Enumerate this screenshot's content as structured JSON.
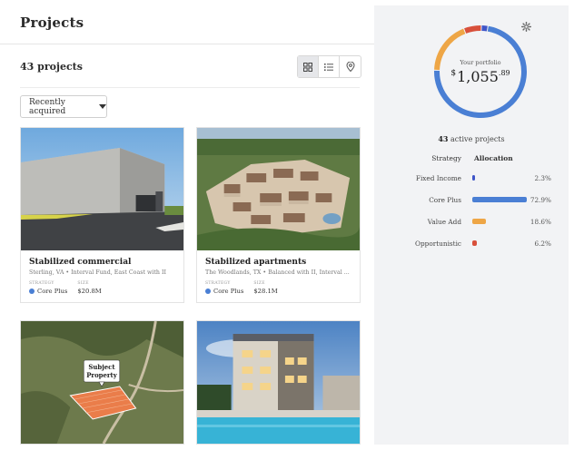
{
  "header": {
    "title": "Projects"
  },
  "toolbar": {
    "count": "43 projects",
    "views": [
      {
        "name": "grid",
        "icon": "grid-icon",
        "active": true
      },
      {
        "name": "list",
        "icon": "list-icon",
        "active": false
      },
      {
        "name": "map",
        "icon": "map-pin-icon",
        "active": false
      }
    ]
  },
  "sort": {
    "label": "Recently acquired"
  },
  "cards": [
    {
      "name": "Stabilized commercial",
      "location": "Sterling, VA • Interval Fund, East Coast with II",
      "strategy_label": "STRATEGY",
      "strategy": "Core Plus",
      "strategy_color": "#4a7fd4",
      "size_label": "SIZE",
      "size": "$20.8M"
    },
    {
      "name": "Stabilized apartments",
      "location": "The Woodlands, TX • Balanced with II, Interval ...",
      "strategy_label": "STRATEGY",
      "strategy": "Core Plus",
      "strategy_color": "#4a7fd4",
      "size_label": "SIZE",
      "size": "$28.1M"
    },
    {
      "image_caption": "Subject Property"
    },
    {}
  ],
  "portfolio": {
    "label": "Your portfolio",
    "currency": "$",
    "value": "1,055",
    "cents": ".89",
    "active_count": "43",
    "active_label": "active projects"
  },
  "allocation": {
    "header_strategy": "Strategy",
    "header_allocation": "Allocation",
    "rows": [
      {
        "name": "Fixed Income",
        "value": 2.3,
        "pct": "2.3%",
        "color": "#3f55c8"
      },
      {
        "name": "Core Plus",
        "value": 72.9,
        "pct": "72.9%",
        "color": "#4a7fd4"
      },
      {
        "name": "Value Add",
        "value": 18.6,
        "pct": "18.6%",
        "color": "#eea646"
      },
      {
        "name": "Opportunistic",
        "value": 6.2,
        "pct": "6.2%",
        "color": "#d8503b"
      }
    ]
  }
}
